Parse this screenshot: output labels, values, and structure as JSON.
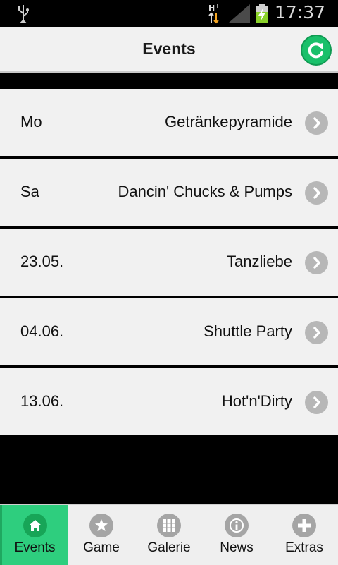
{
  "status_bar": {
    "time": "17:37",
    "network": "H+"
  },
  "header": {
    "title": "Events"
  },
  "events": [
    {
      "date": "Mo",
      "name": "Getränkepyramide"
    },
    {
      "date": "Sa",
      "name": "Dancin' Chucks & Pumps"
    },
    {
      "date": "23.05.",
      "name": "Tanzliebe"
    },
    {
      "date": "04.06.",
      "name": "Shuttle Party"
    },
    {
      "date": "13.06.",
      "name": "Hot'n'Dirty"
    }
  ],
  "bottom_nav": [
    {
      "label": "Events",
      "icon": "home-icon",
      "active": true
    },
    {
      "label": "Game",
      "icon": "star-icon",
      "active": false
    },
    {
      "label": "Galerie",
      "icon": "grid-icon",
      "active": false
    },
    {
      "label": "News",
      "icon": "info-icon",
      "active": false
    },
    {
      "label": "Extras",
      "icon": "plus-icon",
      "active": false
    }
  ],
  "colors": {
    "accent": "#2ece7e",
    "accent_dark": "#17a557",
    "row_background": "#f1f1f1",
    "icon_gray": "#a5a5a5"
  }
}
